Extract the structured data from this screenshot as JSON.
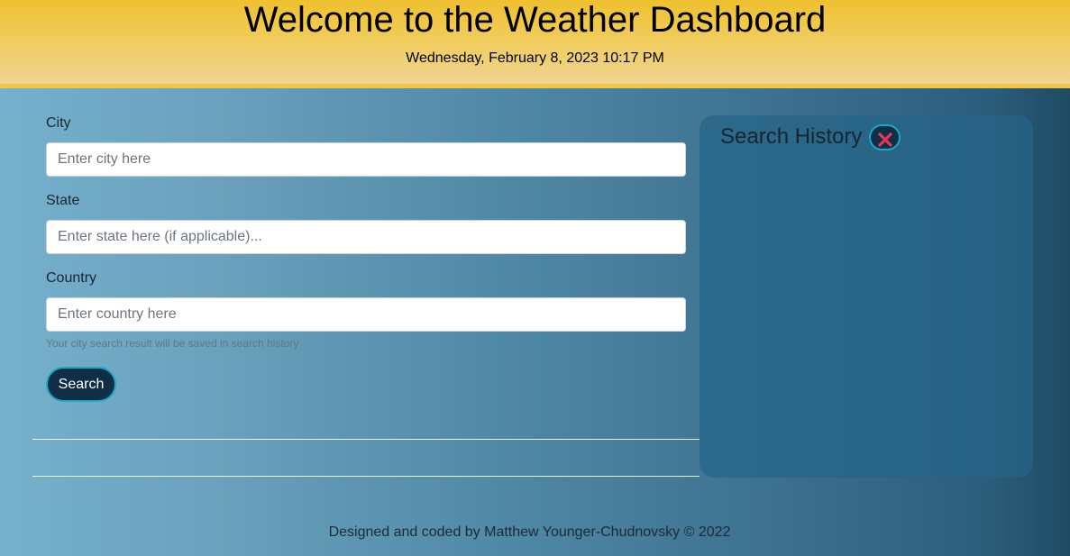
{
  "header": {
    "title": "Welcome to the Weather Dashboard",
    "date": "Wednesday, February 8, 2023 10:17 PM"
  },
  "form": {
    "city_label": "City",
    "city_placeholder": "Enter city here",
    "state_label": "State",
    "state_placeholder": "Enter state here (if applicable)...",
    "country_label": "Country",
    "country_placeholder": "Enter country here",
    "help_text": "Your city search result will be saved in search history",
    "search_label": "Search"
  },
  "history": {
    "title": "Search History",
    "clear_icon": "close-icon",
    "items": []
  },
  "footer": {
    "text": "Designed and coded by Matthew Younger-Chudnovsky © 2022"
  },
  "colors": {
    "header_gold": "#efc02f",
    "button_bg": "#0e2f45",
    "button_border": "#1aa7c9",
    "close_icon": "#e8365d"
  }
}
